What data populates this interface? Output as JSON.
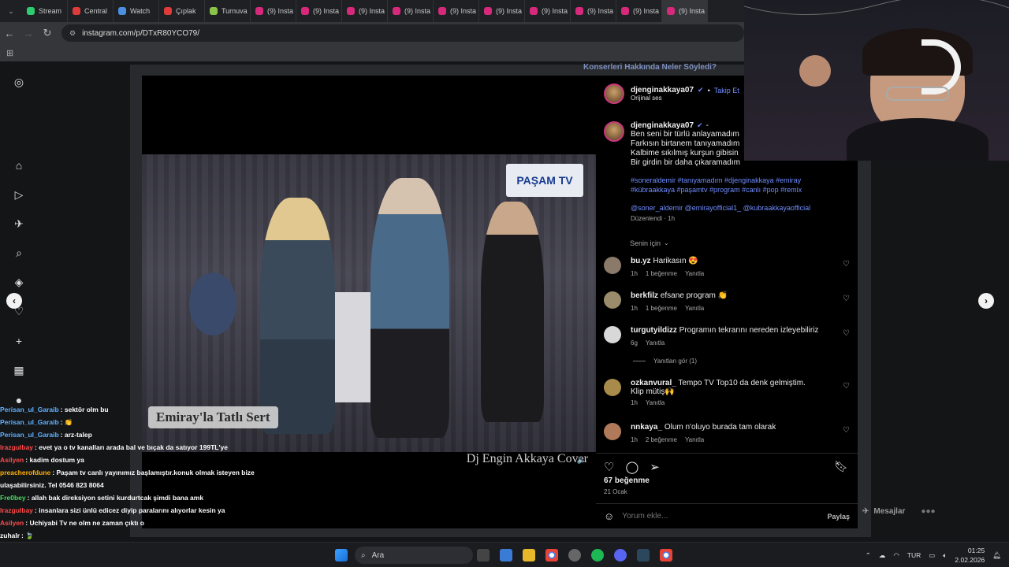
{
  "browser": {
    "tabs": [
      {
        "label": "Stream",
        "color": "#2ecc71"
      },
      {
        "label": "Central",
        "color": "#e03b3b"
      },
      {
        "label": "Watch",
        "color": "#4a90e2"
      },
      {
        "label": "Çıplak",
        "color": "#e03b3b"
      },
      {
        "label": "Turnuva",
        "color": "#8bc34a"
      },
      {
        "label": "(9) Insta",
        "color": "#d6297b"
      },
      {
        "label": "(9) Insta",
        "color": "#d6297b"
      },
      {
        "label": "(9) Insta",
        "color": "#d6297b"
      },
      {
        "label": "(9) Insta",
        "color": "#d6297b"
      },
      {
        "label": "(9) Insta",
        "color": "#d6297b"
      },
      {
        "label": "(9) Insta",
        "color": "#d6297b"
      },
      {
        "label": "(9) Insta",
        "color": "#d6297b"
      },
      {
        "label": "(9) Insta",
        "color": "#d6297b"
      },
      {
        "label": "(9) Insta",
        "color": "#d6297b"
      },
      {
        "label": "(9) Insta",
        "color": "#d6297b"
      }
    ],
    "url": "instagram.com/p/DTxR80YCO79/"
  },
  "background_banner": "Konserleri Hakkında Neler Söyledi?",
  "video": {
    "logo": "PAŞAM TV",
    "caption": "Emiray'la Tatlı Sert",
    "credit": "Dj Engin Akkaya Cover"
  },
  "post": {
    "author": "djenginakkaya07",
    "follow": "Takip Et",
    "audio": "Orijinal ses",
    "caption_author": "djenginakkaya07",
    "caption_suffix": "-",
    "lines": [
      "Ben seni bir türlü anlayamadım",
      "Farkısın birtanem tanıyamadım",
      "Kalbime sıkılmış kurşun gibisin",
      "Bir girdin bir daha çıkaramadım"
    ],
    "hashtags": "#soneraldemir #tanıyamadım #djenginakkaya #emiray #kübraakkaya #paşamtv #program #canlı #pop #remix",
    "mentions": "@soner_aldemir @emirayofficial1_ @kubraakkayaofficial",
    "edited": "Düzenlendi · 1h",
    "sort": "Senin için",
    "comments": [
      {
        "user": "bu.yz",
        "text": "Harikasın 😍",
        "time": "1h",
        "likes": "1 beğenme",
        "reply": "Yanıtla"
      },
      {
        "user": "berkfilz",
        "text": "efsane program 👏",
        "time": "1h",
        "likes": "1 beğenme",
        "reply": "Yanıtla"
      },
      {
        "user": "turgutyildizz",
        "text": "Programın tekrarını nereden izleyebiliriz",
        "time": "6g",
        "likes": "",
        "reply": "Yanıtla"
      },
      {
        "user": "ozkanvural_",
        "text": "Tempo TV Top10 da denk gelmiştim.",
        "text2": "Klip mütiş🙌",
        "time": "1h",
        "likes": "",
        "reply": "Yanıtla"
      },
      {
        "user": "nnkaya_",
        "text": "Olum n'oluyo burada tam olarak",
        "time": "1h",
        "likes": "2 beğenme",
        "reply": "Yanıtla"
      }
    ],
    "view_replies": "Yanıtları gör (1)",
    "like_count": "67 beğenme",
    "date": "21 Ocak",
    "comment_placeholder": "Yorum ekle...",
    "share": "Paylaş"
  },
  "messages": "Mesajlar",
  "chat": [
    {
      "name": "Perisan_ul_Garaib",
      "color": "#5fb0ff",
      "text": "sektör olm bu"
    },
    {
      "name": "Perisan_ul_Garaib",
      "color": "#5fb0ff",
      "text": "👏"
    },
    {
      "name": "Perisan_ul_Garaib",
      "color": "#5fb0ff",
      "text": "arz-talep"
    },
    {
      "name": "Irazgulbay",
      "color": "#ff4a4a",
      "text": "evet ya o tv kanalları arada bal ve bıçak da satıyor 199TL'ye"
    },
    {
      "name": "Asilyen",
      "color": "#ff4a4a",
      "text": "kadim dostum ya"
    },
    {
      "name": "preacherofdune",
      "color": "#ffb000",
      "text": "Paşam tv canlı yayınımız başlamıştır.konuk olmak isteyen bize ulaşabilirsiniz. Tel 0546 823 8064"
    },
    {
      "name": "Fre0bey",
      "color": "#4cd964",
      "text": "allah bak direksiyon setini kurdurtcak şimdi bana amk"
    },
    {
      "name": "Irazgulbay",
      "color": "#ff4a4a",
      "text": "insanlara sizi ünlü edicez diyip paralarını alıyorlar kesin ya"
    },
    {
      "name": "Asilyen",
      "color": "#ff4a4a",
      "text": "Uchiyabi Tv ne olm ne zaman çıktı o"
    },
    {
      "name": "zuhalr",
      "color": "#ffffff",
      "text": "🍃"
    },
    {
      "name": "Perisan_ul_Garaib",
      "color": "#5fb0ff",
      "text": "🌍"
    }
  ],
  "taskbar": {
    "search": "Ara",
    "lang": "TUR",
    "time": "01:25",
    "date": "2.02.2026"
  }
}
